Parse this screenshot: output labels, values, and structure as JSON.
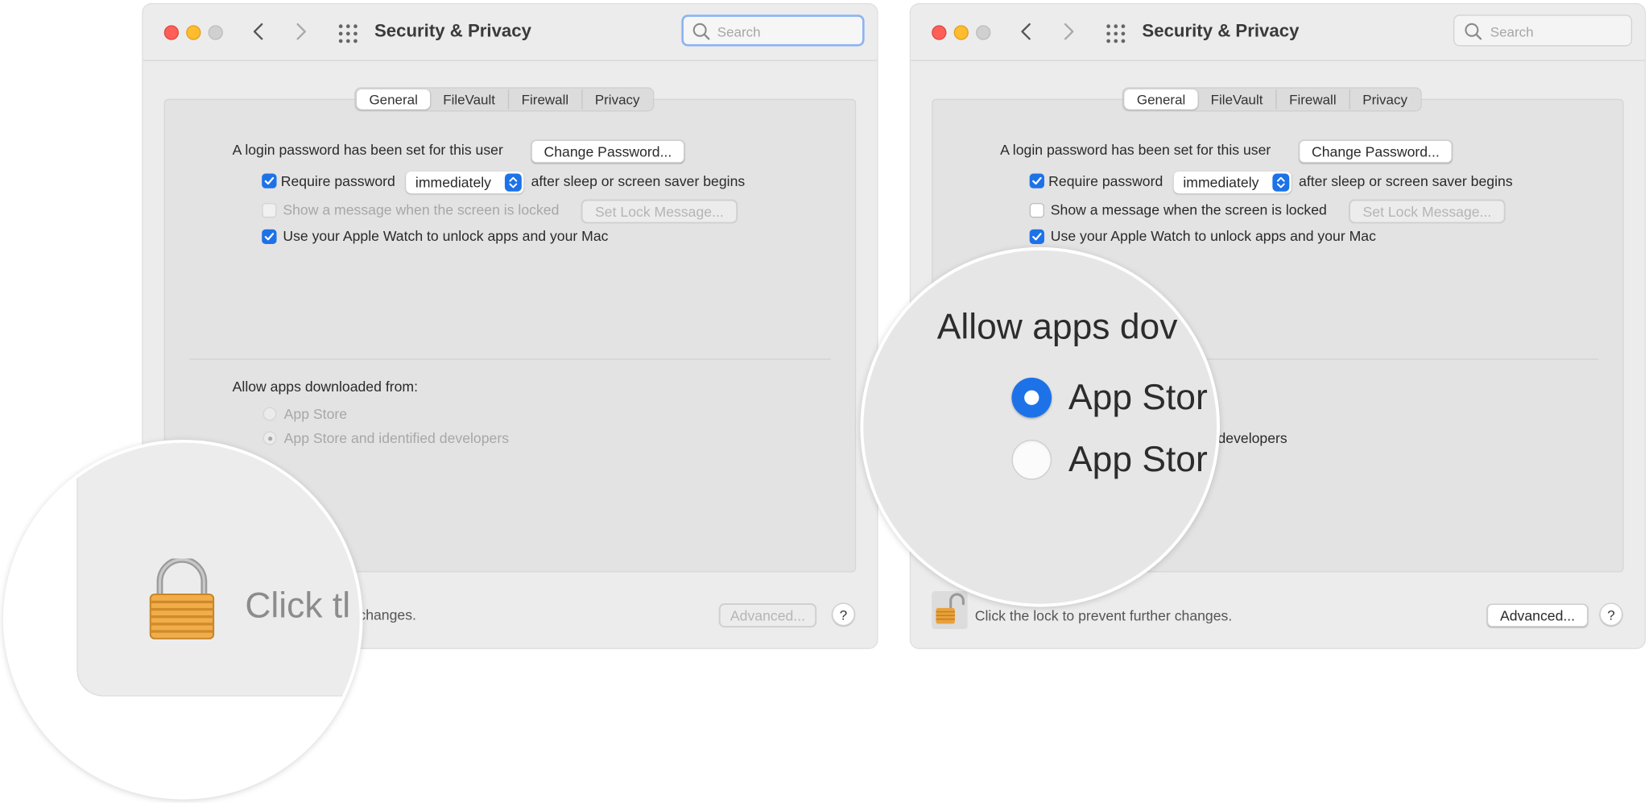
{
  "window": {
    "title": "Security & Privacy",
    "search_placeholder": "Search"
  },
  "tabs": [
    "General",
    "FileVault",
    "Firewall",
    "Privacy"
  ],
  "active_tab": "General",
  "general": {
    "login_text": "A login password has been set for this user",
    "change_password": "Change Password...",
    "require_password": "Require password",
    "require_password_checked": true,
    "require_password_delay": "immediately",
    "after_sleep": "after sleep or screen saver begins",
    "show_message": "Show a message when the screen is locked",
    "show_message_checked": false,
    "set_lock_message": "Set Lock Message...",
    "apple_watch": "Use your Apple Watch to unlock apps and your Mac",
    "apple_watch_checked": true
  },
  "allow_apps": {
    "label": "Allow apps downloaded from:",
    "options": [
      "App Store",
      "App Store and identified developers"
    ],
    "left_selected": "App Store and identified developers",
    "right_visible_option_suffix": "developers"
  },
  "footer": {
    "left_text_partial": "changes.",
    "right_text": "Click the lock to prevent further changes.",
    "advanced": "Advanced...",
    "help": "?"
  },
  "magnifier_left": {
    "text": "Click tl"
  },
  "magnifier_right": {
    "heading": "Allow apps dov",
    "option1": "App Stor",
    "option2": "App Stor",
    "selected": "option1"
  },
  "colors": {
    "accent": "#1d72e8",
    "close": "#fe5f57",
    "minimize": "#febc2e",
    "search_focus": "#8bb3f2",
    "lock_gold": "#e9a23b"
  },
  "icons": [
    "close-icon",
    "minimize-icon",
    "zoom-icon",
    "back-chevron-icon",
    "forward-chevron-icon",
    "grid-icon",
    "search-icon",
    "lock-icon",
    "unlocked-icon",
    "checkmark-icon",
    "popup-arrows-icon"
  ]
}
